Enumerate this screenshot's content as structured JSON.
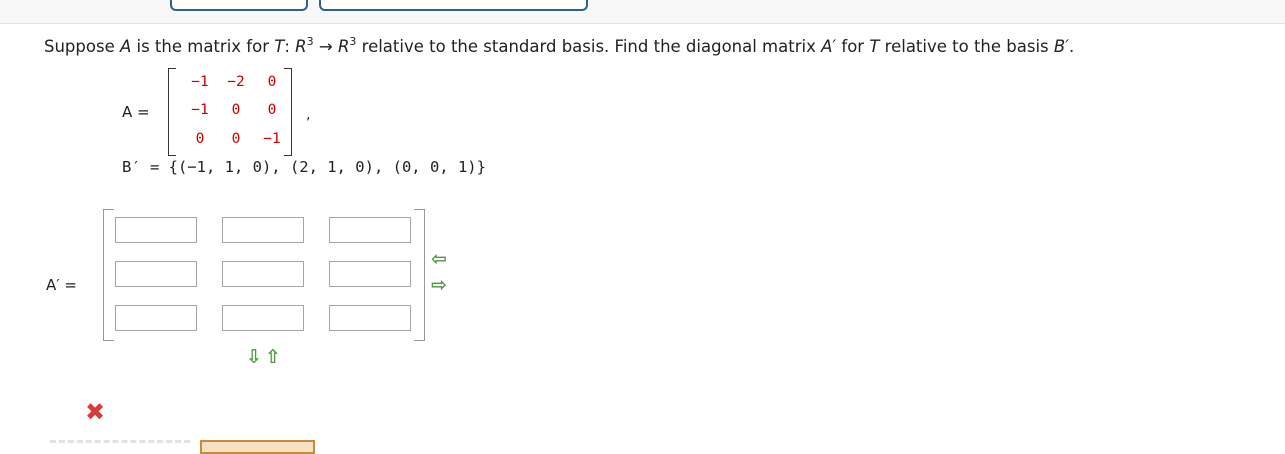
{
  "question": {
    "part1": "Suppose ",
    "var_A": "A",
    "part2": " is the matrix for ",
    "var_T": "T",
    "part3": ": ",
    "R1": "R",
    "exp1": "3",
    "arrow": " → ",
    "R2": "R",
    "exp2": "3",
    "part4": "  relative to the standard basis. Find the diagonal matrix ",
    "var_Ap": "A′",
    "part5": " for ",
    "var_T2": "T",
    "part6": " relative to the basis ",
    "var_Bp": "B′",
    "part7": "."
  },
  "matrix_A": {
    "label": "A =",
    "rows": [
      [
        "−1",
        "−2",
        "0"
      ],
      [
        "−1",
        "0",
        "0"
      ],
      [
        "0",
        "0",
        "−1"
      ]
    ],
    "trailing": ","
  },
  "basis": "B′ = {(−1, 1, 0), (2, 1, 0), (0, 0, 1)}",
  "answer": {
    "label": "A′ =",
    "cells": [
      [
        "",
        "",
        ""
      ],
      [
        "",
        "",
        ""
      ],
      [
        "",
        "",
        ""
      ]
    ]
  },
  "controls": {
    "add_col_arrow": "⇦",
    "remove_col_arrow": "⇨",
    "down_arrow": "⇩",
    "up_arrow": "⇧"
  },
  "status": {
    "mark": "✖",
    "mark_color": "#d93a3a"
  },
  "colors": {
    "matrix_entries": "#cc0000",
    "arrows": "#4a9a3c"
  }
}
